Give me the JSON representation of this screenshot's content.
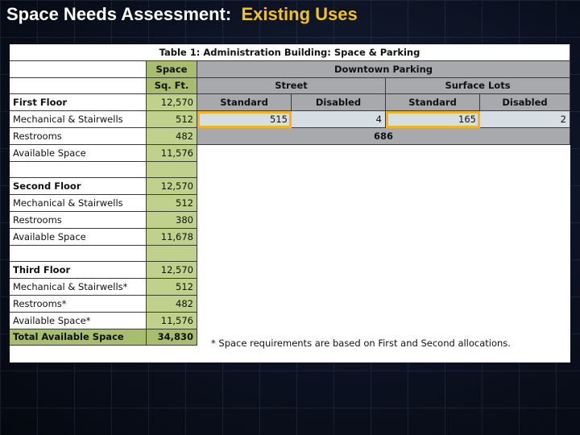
{
  "slide": {
    "title": "Space Needs Assessment:",
    "title_accent": "Existing Uses"
  },
  "table": {
    "caption": "Table 1:  Administration Building:  Space & Parking",
    "space_header": "Space",
    "space_unit": "Sq. Ft.",
    "parking_header": "Downtown Parking",
    "street": "Street",
    "surface_lots": "Surface Lots",
    "standard": "Standard",
    "disabled": "Disabled",
    "parking_values": {
      "street_standard": "515",
      "street_disabled": "4",
      "lots_standard": "165",
      "lots_disabled": "2",
      "total": "686"
    },
    "highlight_color": "#f2b51c",
    "floors": [
      {
        "name": "First Floor",
        "total": "12,570",
        "rows": [
          {
            "label": "Mechanical & Stairwells",
            "value": "512"
          },
          {
            "label": "Restrooms",
            "value": "482"
          },
          {
            "label": "Available Space",
            "value": "11,576"
          }
        ]
      },
      {
        "name": "Second Floor",
        "total": "12,570",
        "rows": [
          {
            "label": "Mechanical & Stairwells",
            "value": "512"
          },
          {
            "label": "Restrooms",
            "value": "380"
          },
          {
            "label": "Available Space",
            "value": "11,678"
          }
        ]
      },
      {
        "name": "Third Floor",
        "total": "12,570",
        "rows": [
          {
            "label": "Mechanical & Stairwells*",
            "value": "512"
          },
          {
            "label": "Restrooms*",
            "value": "482"
          },
          {
            "label": "Available Space*",
            "value": "11,576"
          }
        ]
      }
    ],
    "total_label": "Total Available Space",
    "total_value": "34,830",
    "footnote": "*  Space requirements are based on First and Second allocations."
  }
}
